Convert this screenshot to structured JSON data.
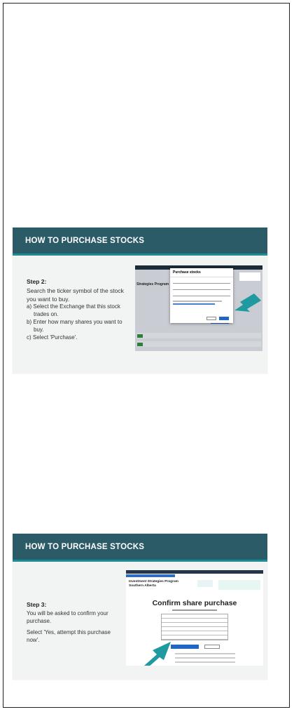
{
  "slides": [
    {
      "header": "HOW TO PURCHASE STOCKS",
      "step_title": "Step 2:",
      "intro": "Search the ticker symbol of the stock you want to buy.",
      "items": [
        "a) Select the Exchange that this stock trades on.",
        "b) Enter how many shares you want to buy.",
        "c) Select 'Purchase'."
      ],
      "screenshot": {
        "modal_title": "Purchase stocks",
        "program": "Strategies Program"
      }
    },
    {
      "header": "HOW TO PURCHASE STOCKS",
      "step_title": "Step 3:",
      "lines": [
        "You will be asked to confirm your purchase.",
        "Select 'Yes, attempt this purchase now'."
      ],
      "screenshot": {
        "program": "Investment Strategies Program",
        "location": "Southern Alberta",
        "confirm_title": "Confirm share purchase"
      }
    }
  ],
  "colors": {
    "header_bg": "#2c5b68",
    "accent": "#1e9aa0",
    "slide_bg": "#f2f4f4"
  }
}
